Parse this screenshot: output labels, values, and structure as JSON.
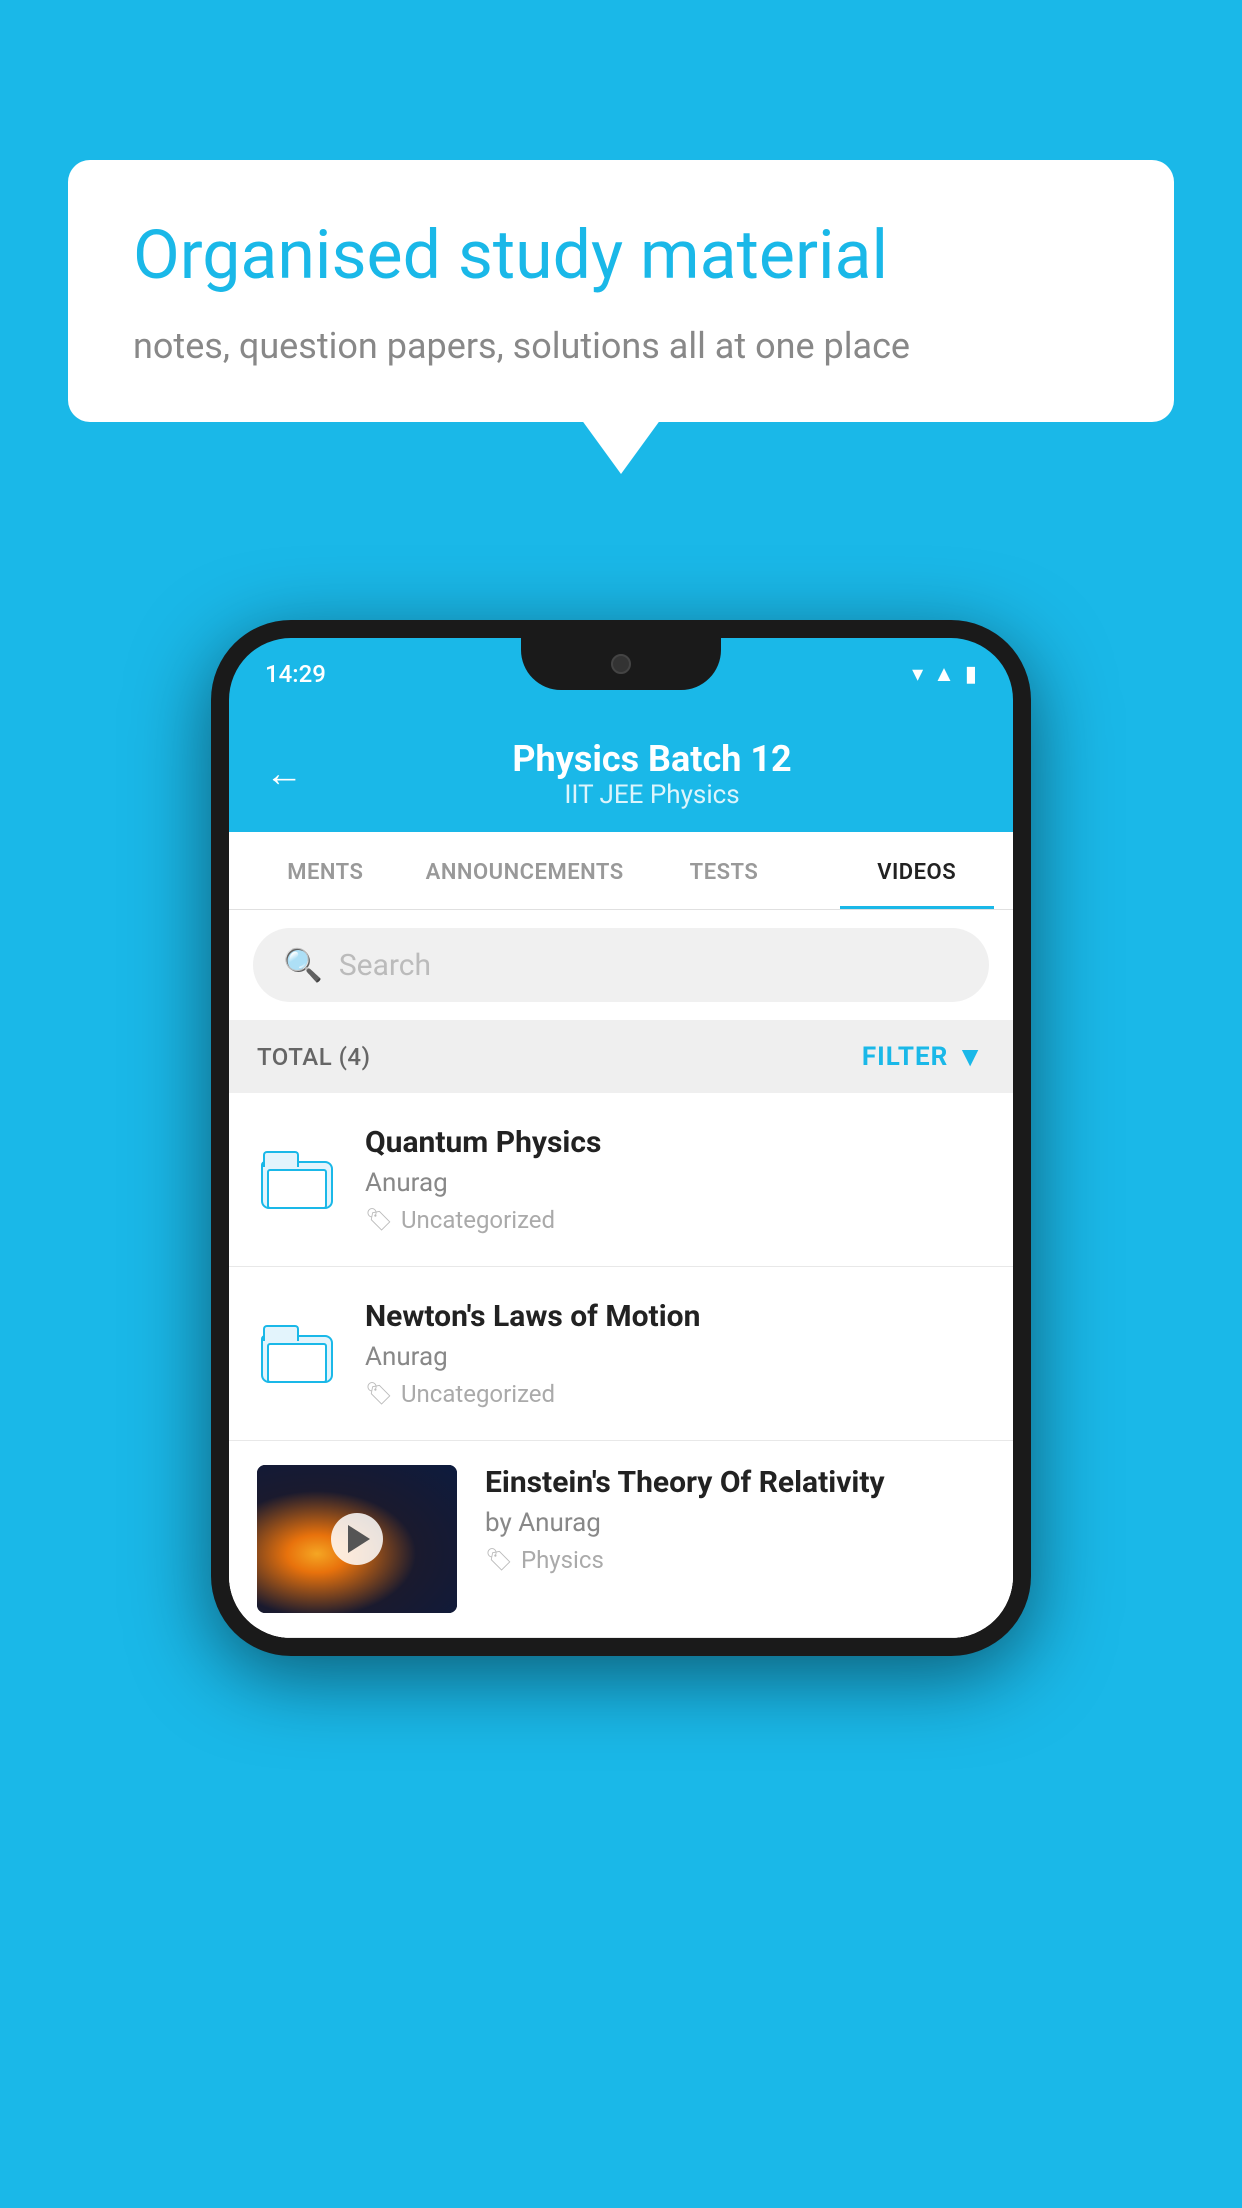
{
  "background_color": "#1ab8e8",
  "bubble": {
    "title": "Organised study material",
    "subtitle": "notes, question papers, solutions all at one place"
  },
  "phone": {
    "status_bar": {
      "time": "14:29"
    },
    "header": {
      "title": "Physics Batch 12",
      "subtitle": "IIT JEE   Physics",
      "back_label": "←"
    },
    "tabs": [
      {
        "label": "MENTS",
        "active": false
      },
      {
        "label": "ANNOUNCEMENTS",
        "active": false
      },
      {
        "label": "TESTS",
        "active": false
      },
      {
        "label": "VIDEOS",
        "active": true
      }
    ],
    "search": {
      "placeholder": "Search"
    },
    "filter": {
      "total_label": "TOTAL (4)",
      "button_label": "FILTER"
    },
    "videos": [
      {
        "id": "quantum",
        "title": "Quantum Physics",
        "author": "Anurag",
        "tag": "Uncategorized",
        "has_thumbnail": false
      },
      {
        "id": "newton",
        "title": "Newton's Laws of Motion",
        "author": "Anurag",
        "tag": "Uncategorized",
        "has_thumbnail": false
      },
      {
        "id": "einstein",
        "title": "Einstein's Theory Of Relativity",
        "author": "by Anurag",
        "tag": "Physics",
        "has_thumbnail": true
      }
    ]
  }
}
